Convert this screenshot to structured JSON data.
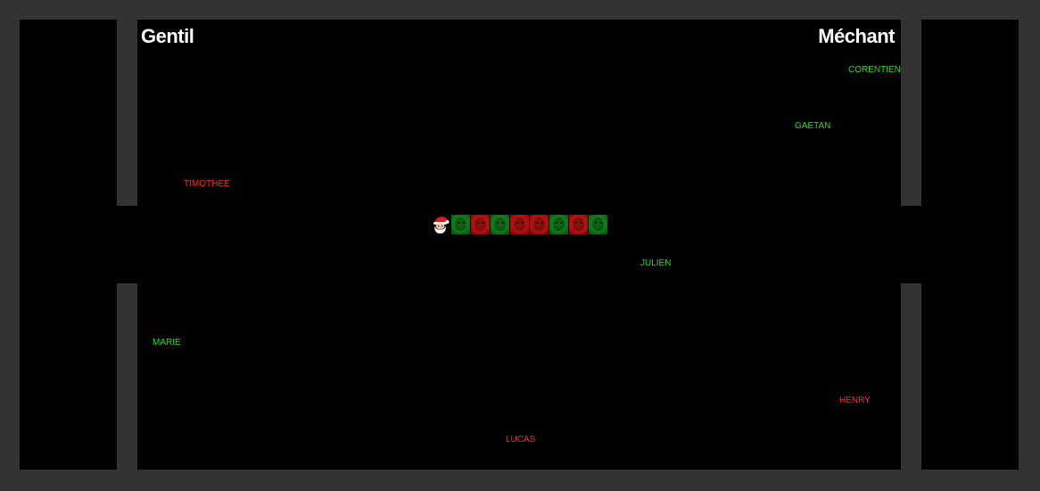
{
  "titles": {
    "good": "Gentil",
    "bad": "Méchant"
  },
  "players": [
    {
      "name": "CORENTIEN",
      "team": "good"
    },
    {
      "name": "GAETAN",
      "team": "good"
    },
    {
      "name": "TIMOTHEE",
      "team": "bad"
    },
    {
      "name": "JULIEN",
      "team": "good"
    },
    {
      "name": "MARIE",
      "team": "good"
    },
    {
      "name": "HENRY",
      "team": "bad"
    },
    {
      "name": "LUCAS",
      "team": "bad"
    }
  ],
  "snake": {
    "head": "santa-icon",
    "segments": [
      "green",
      "red",
      "green",
      "red",
      "red",
      "green",
      "red",
      "green"
    ]
  },
  "colors": {
    "background": "#333333",
    "field": "#000000",
    "good": "#22e01a",
    "bad": "#ff2a1a",
    "title": "#ffffff"
  }
}
